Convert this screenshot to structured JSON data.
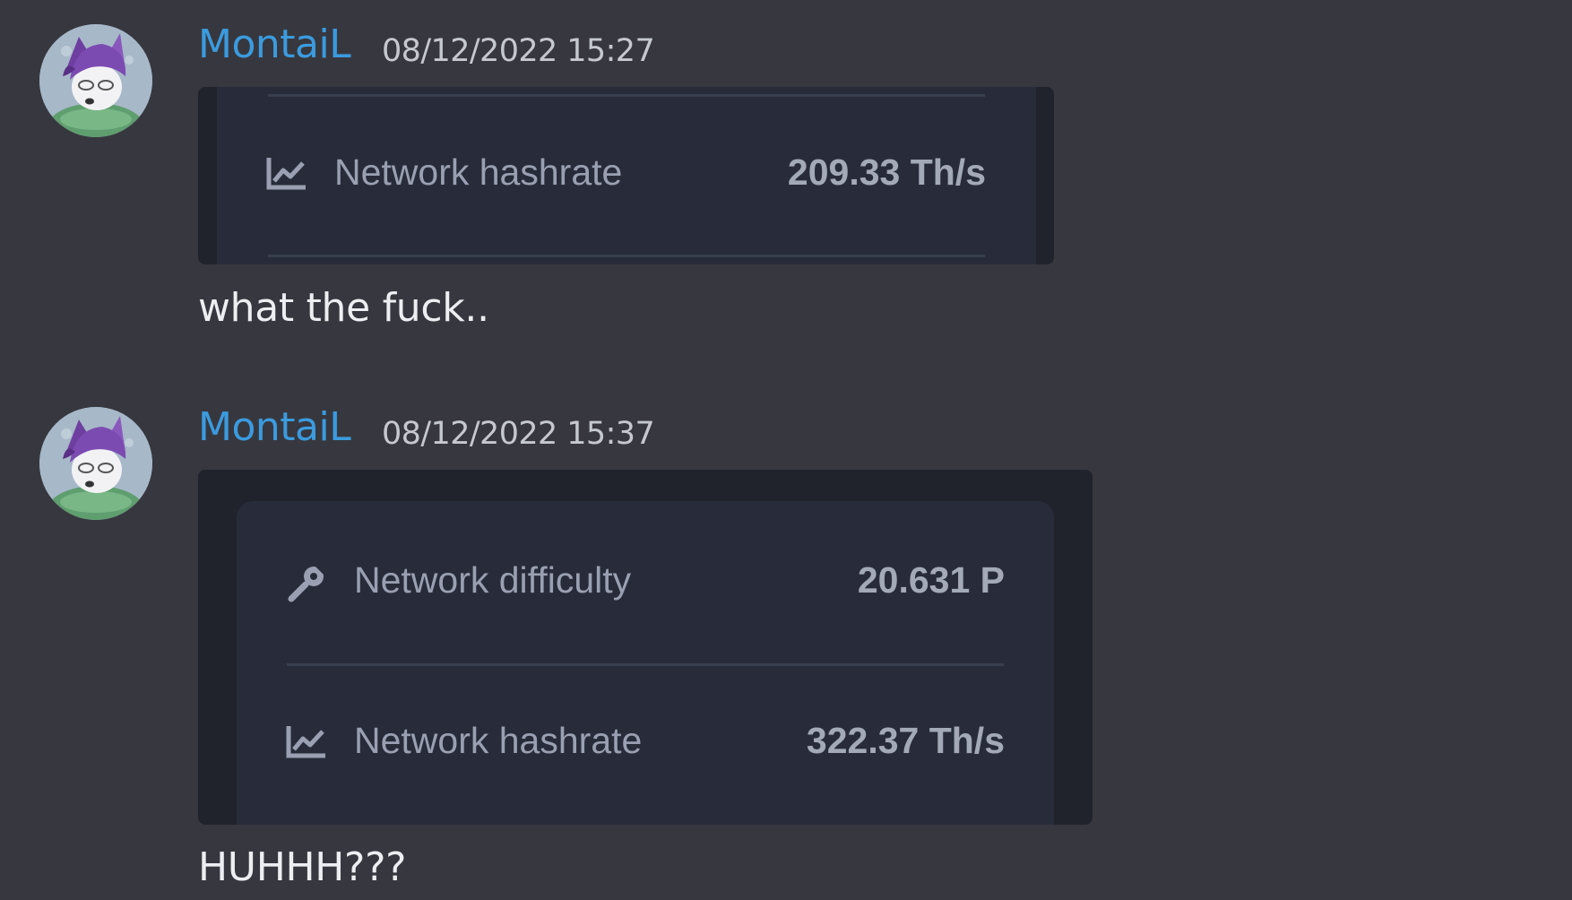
{
  "messages": [
    {
      "author": "MontaiL",
      "timestamp": "08/12/2022 15:27",
      "embed": {
        "rows": [
          {
            "icon": "chart-line-icon",
            "label": "Network hashrate",
            "value": "209.33 Th/s"
          }
        ]
      },
      "text": "what the fuck.."
    },
    {
      "author": "MontaiL",
      "timestamp": "08/12/2022 15:37",
      "embed": {
        "rows": [
          {
            "icon": "wrench-icon",
            "label": "Network difficulty",
            "value": "20.631 P"
          },
          {
            "icon": "chart-line-icon",
            "label": "Network hashrate",
            "value": "322.37 Th/s"
          }
        ]
      },
      "text": "HUHHH???"
    }
  ],
  "colors": {
    "background": "#37383f",
    "author": "#3b9bdf",
    "embed_outer": "#20222c",
    "embed_inner": "#282c3a"
  }
}
